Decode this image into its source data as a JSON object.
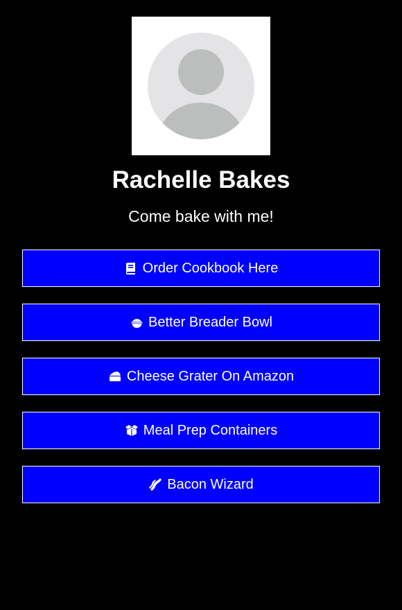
{
  "profile": {
    "name": "Rachelle Bakes",
    "bio": "Come bake with me!",
    "avatar_icon": "default-user-avatar-icon"
  },
  "colors": {
    "background": "#000000",
    "button_fill": "#0000ff",
    "button_border": "#ffffff",
    "text": "#ffffff"
  },
  "links": [
    {
      "label": "Order Cookbook Here",
      "icon": "book-icon"
    },
    {
      "label": "Better Breader Bowl",
      "icon": "bowl-icon"
    },
    {
      "label": "Cheese Grater On Amazon",
      "icon": "cheese-icon"
    },
    {
      "label": "Meal Prep Containers",
      "icon": "box-open-icon"
    },
    {
      "label": "Bacon Wizard",
      "icon": "bacon-icon"
    }
  ]
}
